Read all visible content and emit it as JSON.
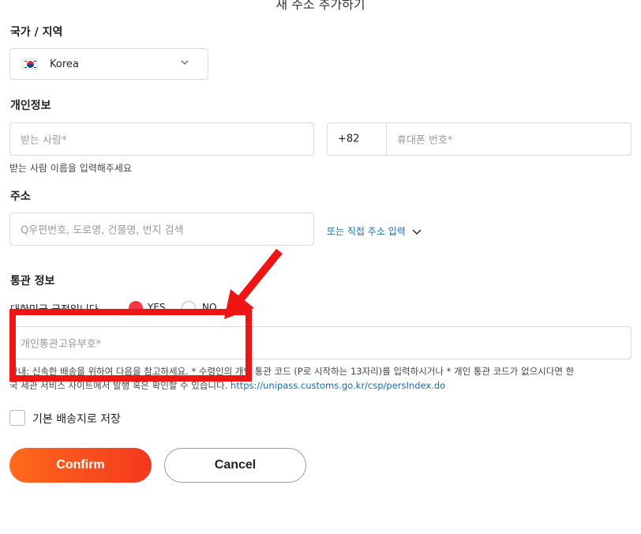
{
  "dialog": {
    "title": "새 주소 추가하기"
  },
  "country": {
    "section_label": "국가 / 지역",
    "selected": "Korea",
    "flag_icon": "korea-flag-icon"
  },
  "personal": {
    "section_label": "개인정보",
    "recipient_placeholder": "받는 사람*",
    "phone_code": "+82",
    "phone_placeholder": "휴대폰 번호*",
    "hint": "받는 사람 이름을 입력해주세요"
  },
  "address": {
    "section_label": "주소",
    "search_placeholder": "Q우편번호, 도로명, 건물명, 번지 검색",
    "manual_link": "또는 직접 주소 입력"
  },
  "customs": {
    "section_label": "통관 정보",
    "question": "대한민국 국적입니다",
    "yes_label": "YES",
    "no_label": "NO",
    "selected": "YES",
    "code_placeholder": "개인통관고유부호*",
    "guide_line1": "안내: 신속한 배송을 위하여 다음을 참고하세요. * 수령인의 개인 통관 코드 (P로 시작하는 13자리)를 입력하시거나 * 개인 통관 코드가 없으시다면 한",
    "guide_line2_text": "국 세관 서비스 사이트에서 발행 혹은 확인할 수 있습니다.",
    "guide_url": "https://unipass.customs.go.kr/csp/persIndex.do"
  },
  "save_default": {
    "label": "기본 배송지로 저장",
    "checked": false
  },
  "actions": {
    "confirm_label": "Confirm",
    "cancel_label": "Cancel"
  },
  "colors": {
    "accent": "#f4381e",
    "radio_on": "#f43847",
    "annotation": "#f01515",
    "link": "#1a6ab2"
  }
}
